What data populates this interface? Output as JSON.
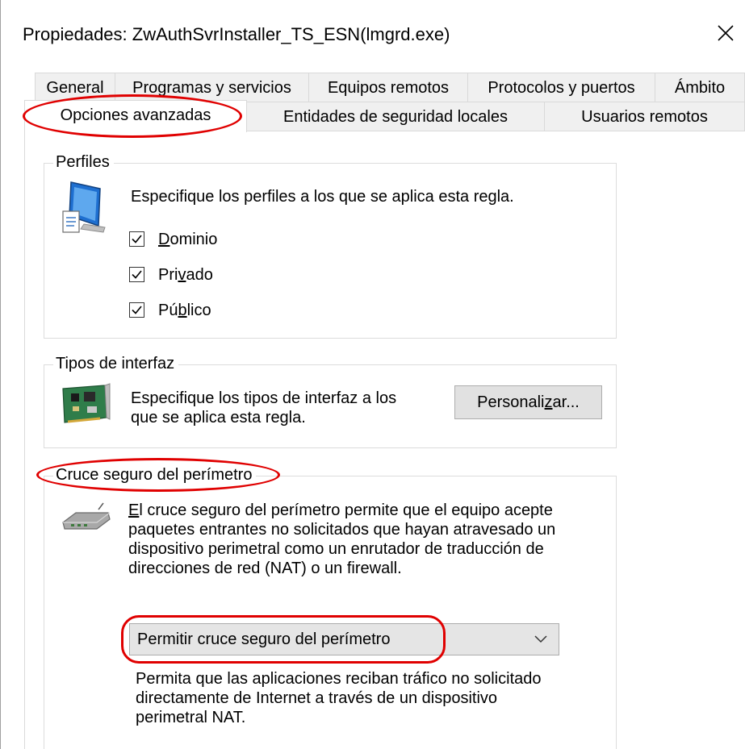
{
  "window": {
    "title": "Propiedades: ZwAuthSvrInstaller_TS_ESN(lmgrd.exe)"
  },
  "tabs_row1": [
    {
      "label": "General"
    },
    {
      "label": "Programas y servicios"
    },
    {
      "label": "Equipos remotos"
    },
    {
      "label": "Protocolos y puertos"
    },
    {
      "label": "Ámbito"
    }
  ],
  "tabs_row2": [
    {
      "label": "Opciones avanzadas",
      "active": true
    },
    {
      "label": "Entidades de seguridad locales"
    },
    {
      "label": "Usuarios remotos"
    }
  ],
  "profiles": {
    "group_label": "Perfiles",
    "description": "Especifique los perfiles a los que se aplica esta regla.",
    "items": [
      {
        "pre": "",
        "accel": "D",
        "post": "ominio",
        "checked": true
      },
      {
        "pre": "Pri",
        "accel": "v",
        "post": "ado",
        "checked": true
      },
      {
        "pre": "Pú",
        "accel": "b",
        "post": "lico",
        "checked": true
      }
    ]
  },
  "interface": {
    "group_label": "Tipos de interfaz",
    "description_line1": "Especifique los tipos de interfaz a los",
    "description_line2": "que se aplica esta regla.",
    "button_pre": "Personali",
    "button_accel": "z",
    "button_post": "ar..."
  },
  "edge": {
    "group_label": "Cruce seguro del perímetro",
    "desc_accel": "E",
    "desc_line1_rest": "l cruce seguro del perímetro permite que el equipo acepte",
    "desc_line2": "paquetes entrantes no solicitados que hayan atravesado un",
    "desc_line3": "dispositivo perimetral como un enrutador de traducción de",
    "desc_line4": "direcciones de red (NAT) o un firewall.",
    "selected_option": "Permitir cruce seguro del perímetro",
    "help_line1": "Permita que las aplicaciones reciban tráfico no solicitado",
    "help_line2": "directamente de Internet a través de un dispositivo",
    "help_line3": "perimetral NAT."
  },
  "colors": {
    "highlight": "#e00000",
    "tab_bg": "#f0f0f0",
    "button_bg": "#e1e1e1"
  }
}
